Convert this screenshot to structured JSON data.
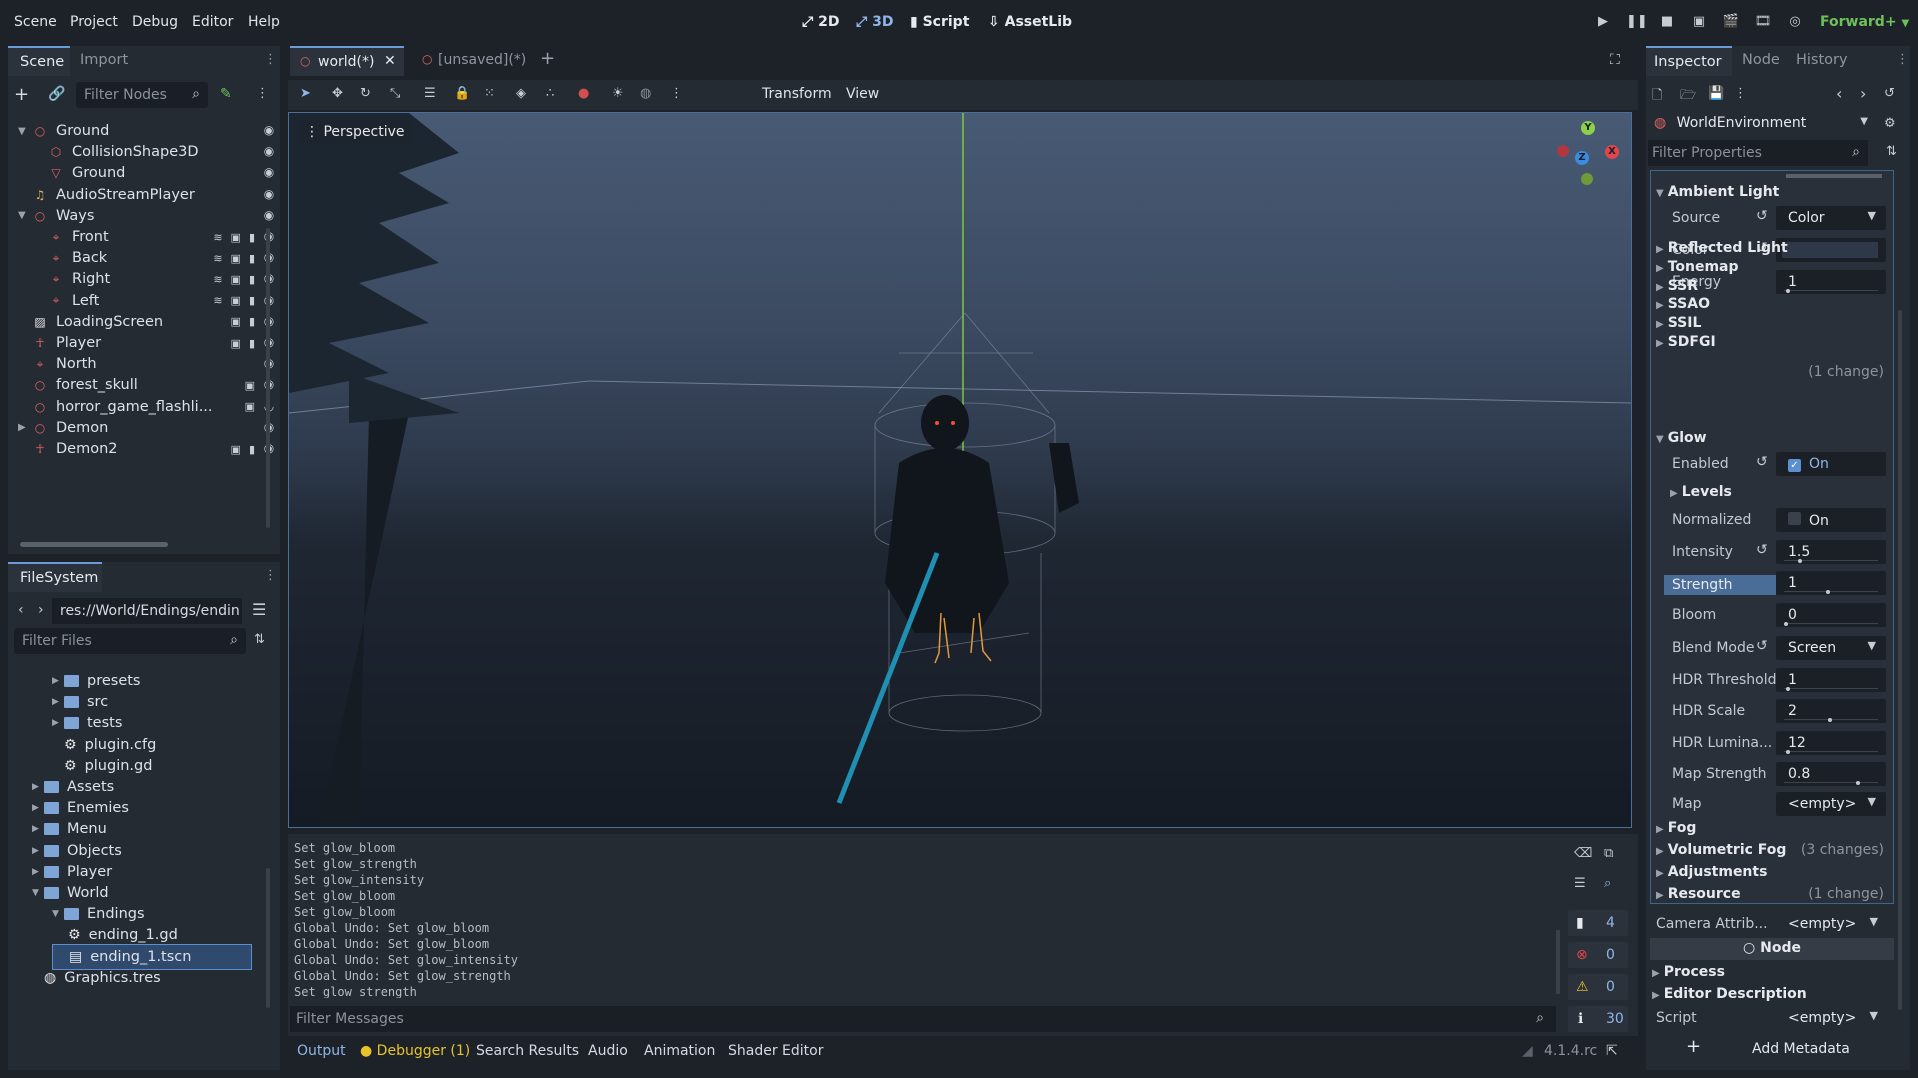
{
  "menu": [
    "Scene",
    "Project",
    "Debug",
    "Editor",
    "Help"
  ],
  "modes": [
    "2D",
    "3D",
    "Script",
    "AssetLib"
  ],
  "renderer": "Forward+",
  "left_tabs": {
    "scene": "Scene",
    "import": "Import"
  },
  "filter_nodes_placeholder": "Filter Nodes",
  "scene_tree": [
    {
      "label": "Ground",
      "color": "#e06363",
      "icon": "node3d-icon"
    },
    {
      "label": "CollisionShape3D",
      "color": "#e06363",
      "icon": "collision-icon"
    },
    {
      "label": "Ground",
      "color": "#e06363",
      "icon": "mesh-icon"
    },
    {
      "label": "AudioStreamPlayer",
      "color": "#e0b463",
      "icon": "audio-icon"
    },
    {
      "label": "Ways",
      "color": "#e06363",
      "icon": "node3d-icon"
    },
    {
      "label": "Front",
      "color": "#e06363",
      "icon": "marker-icon"
    },
    {
      "label": "Back",
      "color": "#e06363",
      "icon": "marker-icon"
    },
    {
      "label": "Right",
      "color": "#e06363",
      "icon": "marker-icon"
    },
    {
      "label": "Left",
      "color": "#e06363",
      "icon": "marker-icon"
    },
    {
      "label": "LoadingScreen",
      "color": "#e6e6e6",
      "icon": "control-icon"
    },
    {
      "label": "Player",
      "color": "#e06363",
      "icon": "character-icon"
    },
    {
      "label": "North",
      "color": "#e06363",
      "icon": "marker-icon"
    },
    {
      "label": "forest_skull",
      "color": "#e06363",
      "icon": "node3d-icon"
    },
    {
      "label": "horror_game_flashli...",
      "color": "#e06363",
      "icon": "node3d-icon"
    },
    {
      "label": "Demon",
      "color": "#e06363",
      "icon": "node3d-icon"
    },
    {
      "label": "Demon2",
      "color": "#e06363",
      "icon": "character-icon"
    }
  ],
  "filesystem": {
    "title": "FileSystem",
    "path": "res://World/Endings/endin",
    "filter_placeholder": "Filter Files",
    "items": [
      {
        "label": "presets",
        "type": "folder",
        "indent": 2
      },
      {
        "label": "src",
        "type": "folder",
        "indent": 2
      },
      {
        "label": "tests",
        "type": "folder",
        "indent": 2
      },
      {
        "label": "plugin.cfg",
        "type": "gear",
        "indent": 2
      },
      {
        "label": "plugin.gd",
        "type": "gear",
        "indent": 2
      },
      {
        "label": "Assets",
        "type": "folder",
        "indent": 1
      },
      {
        "label": "Enemies",
        "type": "folder",
        "indent": 1
      },
      {
        "label": "Menu",
        "type": "folder",
        "indent": 1
      },
      {
        "label": "Objects",
        "type": "folder",
        "indent": 1
      },
      {
        "label": "Player",
        "type": "folder",
        "indent": 1
      },
      {
        "label": "World",
        "type": "folder",
        "indent": 1
      },
      {
        "label": "Endings",
        "type": "folder",
        "indent": 2
      },
      {
        "label": "ending_1.gd",
        "type": "gear",
        "indent": 3
      },
      {
        "label": "ending_1.tscn",
        "type": "scene",
        "indent": 3
      },
      {
        "label": "Graphics.tres",
        "type": "globe",
        "indent": 1
      }
    ]
  },
  "editor_tabs": [
    {
      "label": "world(*)",
      "active": true
    },
    {
      "label": "[unsaved](*)",
      "active": false
    }
  ],
  "viewport_toolbar": {
    "transform": "Transform",
    "view": "View"
  },
  "viewport": {
    "label": "Perspective",
    "gizmo": {
      "x": "X",
      "y": "Y",
      "z": "Z"
    }
  },
  "console": {
    "lines": [
      "Set glow_bloom",
      "Set glow_strength",
      "Set glow_intensity",
      "Set glow_bloom",
      "Set glow_bloom",
      "Global Undo: Set glow_bloom",
      "Global Undo: Set glow_bloom",
      "Global Undo: Set glow_intensity",
      "Global Undo: Set glow_strength",
      "Set glow_strength"
    ],
    "filter_placeholder": "Filter Messages",
    "counts": {
      "messages": "4",
      "errors": "0",
      "warnings": "0",
      "info": "30"
    }
  },
  "bottom_tabs": [
    "Output",
    "Debugger (1)",
    "Search Results",
    "Audio",
    "Animation",
    "Shader Editor"
  ],
  "version": "4.1.4.rc",
  "inspector": {
    "tabs": [
      "Inspector",
      "Node",
      "History"
    ],
    "object": "WorldEnvironment",
    "filter_placeholder": "Filter Properties",
    "ambient_title": "Ambient Light",
    "source_label": "Source",
    "source_value": "Color",
    "color_label": "Color",
    "energy_label": "Energy",
    "energy_value": "1",
    "sections_a": [
      "Reflected Light",
      "Tonemap",
      "SSR",
      "SSAO",
      "SSIL",
      "SDFGI"
    ],
    "ssao_changes": "(1 change)",
    "glow_title": "Glow",
    "enabled_label": "Enabled",
    "enabled_value": "On",
    "levels_label": "Levels",
    "normalized_label": "Normalized",
    "normalized_value": "On",
    "props": [
      {
        "label": "Intensity",
        "value": "1.5"
      },
      {
        "label": "Strength",
        "value": "1"
      },
      {
        "label": "Bloom",
        "value": "0"
      }
    ],
    "blend_label": "Blend Mode",
    "blend_value": "Screen",
    "props2": [
      {
        "label": "HDR Threshold",
        "value": "1"
      },
      {
        "label": "HDR Scale",
        "value": "2"
      },
      {
        "label": "HDR Lumina...",
        "value": "12"
      },
      {
        "label": "Map Strength",
        "value": "0.8"
      }
    ],
    "map_label": "Map",
    "map_value": "<empty>",
    "fog": "Fog",
    "vfog": "Volumetric Fog",
    "vfog_changes": "(3 changes)",
    "adjustments": "Adjustments",
    "resource": "Resource",
    "resource_changes": "(1 change)",
    "camera_label": "Camera Attrib...",
    "camera_value": "<empty>",
    "node_header": "Node",
    "process": "Process",
    "editor_desc": "Editor Description",
    "script_label": "Script",
    "script_value": "<empty>",
    "add_metadata": "Add Metadata"
  }
}
